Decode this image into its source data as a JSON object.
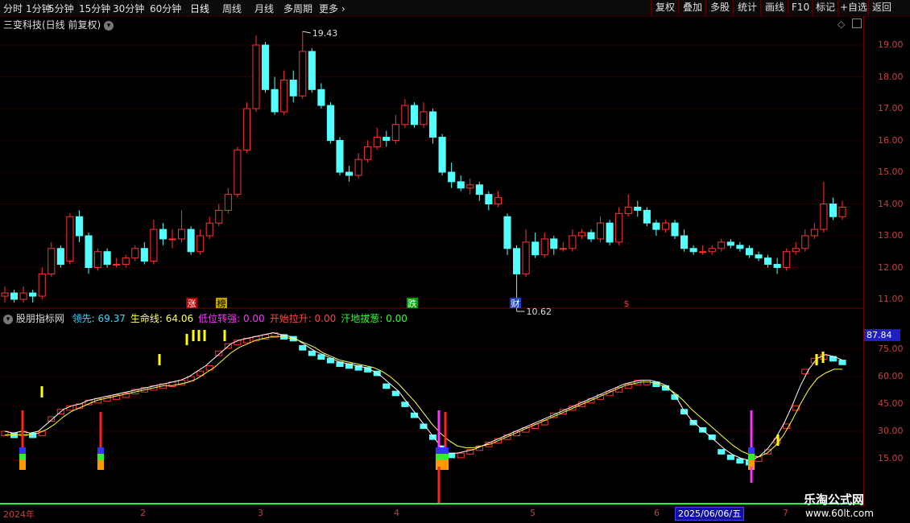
{
  "toolbar": {
    "periods": [
      "分时",
      "1分钟",
      "5分钟",
      "15分钟",
      "30分钟",
      "60分钟",
      "日线",
      "周线",
      "月线",
      "多周期",
      "更多"
    ],
    "active_period": "日线",
    "actions": [
      "复权",
      "叠加",
      "多股",
      "统计",
      "画线",
      "F10",
      "标记",
      "+自选",
      "返回"
    ]
  },
  "main_chart": {
    "title": "三变科技(日线 前复权)",
    "high_label": "19.43",
    "low_label": "10.62",
    "y_ticks": [
      "19.00",
      "18.00",
      "17.00",
      "16.00",
      "15.00",
      "14.00",
      "13.00",
      "12.00",
      "11.00"
    ],
    "event_flags": [
      "涨",
      "榜",
      "跌",
      "财",
      "$"
    ]
  },
  "indicator": {
    "name": "股朋指标网",
    "legend": [
      {
        "label": "领先:",
        "value": "69.37",
        "color": "#33ddff"
      },
      {
        "label": "生命线:",
        "value": "64.06",
        "color": "#ffff66"
      },
      {
        "label": "低位转强:",
        "value": "0.00",
        "color": "#ff33ff"
      },
      {
        "label": "开始拉升:",
        "value": "0.00",
        "color": "#ff4444"
      },
      {
        "label": "汗地拔葱:",
        "value": "0.00",
        "color": "#33ff33"
      }
    ],
    "current_value": "87.84",
    "y_ticks": [
      "75.00",
      "60.00",
      "45.00",
      "30.00",
      "15.00"
    ]
  },
  "x_axis": {
    "labels": [
      "2024年",
      "2",
      "3",
      "4",
      "5",
      "6",
      "7"
    ],
    "cursor_date": "2025/06/06/五"
  },
  "watermark": {
    "name": "乐淘公式网",
    "url": "www.60lt.com"
  },
  "chart_data": {
    "type": "candlestick",
    "price_range": [
      10.6,
      19.8
    ],
    "indicator_range": [
      10,
      90
    ],
    "colors": {
      "up": "#ff3333",
      "down": "#54ffff",
      "lead_line": "#ffffff",
      "life_line": "#ffff44"
    },
    "candles": [
      [
        11.1,
        11.2,
        10.9,
        11.4
      ],
      [
        11.2,
        11.0,
        10.9,
        11.3
      ],
      [
        11.0,
        11.2,
        10.9,
        11.4
      ],
      [
        11.2,
        11.1,
        10.9,
        11.3
      ],
      [
        11.1,
        11.8,
        11.0,
        12.0
      ],
      [
        11.8,
        12.6,
        11.7,
        12.8
      ],
      [
        12.6,
        12.1,
        12.0,
        12.7
      ],
      [
        12.2,
        13.6,
        12.1,
        13.7
      ],
      [
        13.6,
        13.0,
        12.8,
        13.8
      ],
      [
        13.0,
        12.0,
        11.8,
        13.1
      ],
      [
        12.0,
        12.5,
        11.9,
        12.6
      ],
      [
        12.5,
        12.1,
        12.0,
        12.6
      ],
      [
        12.1,
        12.1,
        12.0,
        12.3
      ],
      [
        12.1,
        12.3,
        12.0,
        12.4
      ],
      [
        12.3,
        12.6,
        12.2,
        12.7
      ],
      [
        12.6,
        12.2,
        12.1,
        12.8
      ],
      [
        12.2,
        13.2,
        12.1,
        13.5
      ],
      [
        13.2,
        12.9,
        12.7,
        13.4
      ],
      [
        12.9,
        12.9,
        12.6,
        13.2
      ],
      [
        12.9,
        13.2,
        12.8,
        13.8
      ],
      [
        13.2,
        12.5,
        12.4,
        13.3
      ],
      [
        12.5,
        13.0,
        12.4,
        13.2
      ],
      [
        13.0,
        13.4,
        12.9,
        13.6
      ],
      [
        13.4,
        13.8,
        13.3,
        14.0
      ],
      [
        13.8,
        14.3,
        13.7,
        14.5
      ],
      [
        14.3,
        15.7,
        14.2,
        15.8
      ],
      [
        15.7,
        17.0,
        15.6,
        17.2
      ],
      [
        17.0,
        19.0,
        16.9,
        19.3
      ],
      [
        19.0,
        17.6,
        17.5,
        19.1
      ],
      [
        17.6,
        16.9,
        16.8,
        18.0
      ],
      [
        16.9,
        17.9,
        16.8,
        18.2
      ],
      [
        17.9,
        17.4,
        17.2,
        18.2
      ],
      [
        17.4,
        18.8,
        17.3,
        19.43
      ],
      [
        18.8,
        17.6,
        17.5,
        18.9
      ],
      [
        17.6,
        17.1,
        17.0,
        17.8
      ],
      [
        17.1,
        16.0,
        15.9,
        17.2
      ],
      [
        16.0,
        15.0,
        14.9,
        16.1
      ],
      [
        15.0,
        14.9,
        14.7,
        15.2
      ],
      [
        14.9,
        15.4,
        14.8,
        15.6
      ],
      [
        15.4,
        15.8,
        15.3,
        16.0
      ],
      [
        15.8,
        16.1,
        15.7,
        16.4
      ],
      [
        16.1,
        16.0,
        15.8,
        16.3
      ],
      [
        16.0,
        16.5,
        15.9,
        16.8
      ],
      [
        16.5,
        17.1,
        16.4,
        17.3
      ],
      [
        17.1,
        16.5,
        16.4,
        17.2
      ],
      [
        16.5,
        16.9,
        16.4,
        17.2
      ],
      [
        16.9,
        16.1,
        15.9,
        17.0
      ],
      [
        16.1,
        15.0,
        14.9,
        16.2
      ],
      [
        15.0,
        14.7,
        14.5,
        15.3
      ],
      [
        14.7,
        14.5,
        14.4,
        14.9
      ],
      [
        14.5,
        14.6,
        14.3,
        14.8
      ],
      [
        14.6,
        14.3,
        14.1,
        14.7
      ],
      [
        14.3,
        14.0,
        13.8,
        14.4
      ],
      [
        14.0,
        14.2,
        13.9,
        14.4
      ],
      [
        13.6,
        12.6,
        12.4,
        13.7
      ],
      [
        12.6,
        11.8,
        10.62,
        12.7
      ],
      [
        11.8,
        12.8,
        11.7,
        13.2
      ],
      [
        12.8,
        12.4,
        12.3,
        13.1
      ],
      [
        12.4,
        12.9,
        12.3,
        13.1
      ],
      [
        12.9,
        12.6,
        12.4,
        13.0
      ],
      [
        12.6,
        12.6,
        12.5,
        12.8
      ],
      [
        12.6,
        13.0,
        12.5,
        13.2
      ],
      [
        13.0,
        13.1,
        12.9,
        13.2
      ],
      [
        13.1,
        12.9,
        12.8,
        13.2
      ],
      [
        12.9,
        13.4,
        12.8,
        13.6
      ],
      [
        13.4,
        12.8,
        12.7,
        13.5
      ],
      [
        12.8,
        13.7,
        12.7,
        13.9
      ],
      [
        13.7,
        13.9,
        13.6,
        14.3
      ],
      [
        13.9,
        13.8,
        13.6,
        14.1
      ],
      [
        13.8,
        13.4,
        13.3,
        13.9
      ],
      [
        13.4,
        13.2,
        13.0,
        13.5
      ],
      [
        13.2,
        13.4,
        13.1,
        13.5
      ],
      [
        13.4,
        13.0,
        12.9,
        13.5
      ],
      [
        13.0,
        12.6,
        12.5,
        13.2
      ],
      [
        12.6,
        12.5,
        12.4,
        12.7
      ],
      [
        12.5,
        12.5,
        12.4,
        12.7
      ],
      [
        12.5,
        12.6,
        12.4,
        12.7
      ],
      [
        12.6,
        12.8,
        12.5,
        12.9
      ],
      [
        12.8,
        12.7,
        12.6,
        12.9
      ],
      [
        12.7,
        12.6,
        12.5,
        12.8
      ],
      [
        12.6,
        12.4,
        12.3,
        12.7
      ],
      [
        12.4,
        12.3,
        12.2,
        12.5
      ],
      [
        12.3,
        12.1,
        12.0,
        12.4
      ],
      [
        12.1,
        12.0,
        11.8,
        12.3
      ],
      [
        12.0,
        12.5,
        11.9,
        12.6
      ],
      [
        12.5,
        12.6,
        12.4,
        12.8
      ],
      [
        12.6,
        13.0,
        12.5,
        13.2
      ],
      [
        13.0,
        13.2,
        12.9,
        13.4
      ],
      [
        13.2,
        14.0,
        13.1,
        14.7
      ],
      [
        14.0,
        13.6,
        13.5,
        14.2
      ],
      [
        13.6,
        13.9,
        13.5,
        14.1
      ]
    ],
    "lead_line": [
      30,
      29,
      30,
      29,
      30,
      34,
      38,
      42,
      44,
      45,
      47,
      48,
      49,
      50,
      51,
      52,
      53,
      54,
      55,
      56,
      57,
      58,
      60,
      63,
      66,
      70,
      74,
      78,
      80,
      81,
      82,
      83,
      84,
      83,
      82,
      80,
      77,
      74,
      72,
      70,
      68,
      67,
      66,
      65,
      63,
      60,
      56,
      52,
      46,
      40,
      34,
      28,
      22,
      18,
      18,
      19,
      20,
      22,
      24,
      26,
      28,
      30,
      32,
      34,
      36,
      38,
      40,
      42,
      44,
      46,
      48,
      50,
      52,
      54,
      56,
      57,
      58,
      58,
      57,
      55,
      50,
      42,
      36,
      32,
      28,
      24,
      20,
      17,
      15,
      14,
      16,
      20,
      26,
      34,
      44,
      55,
      64,
      70,
      72,
      71,
      69
    ],
    "life_line": [
      28,
      28,
      28,
      28,
      29,
      31,
      34,
      38,
      41,
      43,
      45,
      47,
      48,
      49,
      50,
      51,
      52,
      53,
      54,
      55,
      55,
      56,
      57,
      59,
      62,
      65,
      69,
      73,
      76,
      78,
      80,
      81,
      82,
      82,
      81,
      80,
      78,
      76,
      73,
      71,
      69,
      68,
      67,
      66,
      65,
      63,
      60,
      56,
      51,
      46,
      40,
      34,
      29,
      25,
      22,
      21,
      21,
      22,
      23,
      25,
      27,
      29,
      31,
      33,
      35,
      37,
      39,
      41,
      43,
      45,
      47,
      49,
      51,
      53,
      55,
      56,
      57,
      57,
      56,
      54,
      51,
      47,
      42,
      38,
      34,
      30,
      26,
      22,
      19,
      17,
      16,
      18,
      22,
      28,
      36,
      45,
      53,
      59,
      62,
      64,
      64
    ]
  }
}
